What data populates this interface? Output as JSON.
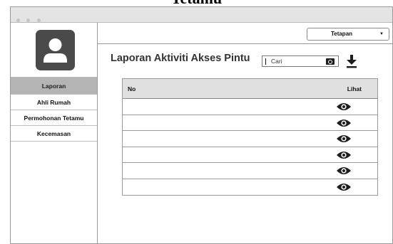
{
  "caption": "Tetamu",
  "window": {
    "dots": [
      "",
      "",
      ""
    ]
  },
  "sidebar": {
    "avatar_icon": "user-avatar-icon",
    "items": [
      {
        "label": "Laporan",
        "active": true
      },
      {
        "label": "Ahli Rumah",
        "active": false
      },
      {
        "label": "Permohonan Tetamu",
        "active": false
      },
      {
        "label": "Kecemasan",
        "active": false
      }
    ]
  },
  "header": {
    "dropdown_label": "Tetapan",
    "dropdown_icon": "caret-down-icon"
  },
  "main": {
    "title": "Laporan Aktiviti Akses Pintu",
    "search": {
      "placeholder": "Cari",
      "icon": "search-icon"
    },
    "download_icon": "download-icon",
    "table": {
      "columns": [
        "No",
        "Lihat"
      ],
      "rows": [
        {
          "no": "",
          "view_icon": "eye-icon"
        },
        {
          "no": "",
          "view_icon": "eye-icon"
        },
        {
          "no": "",
          "view_icon": "eye-icon"
        },
        {
          "no": "",
          "view_icon": "eye-icon"
        },
        {
          "no": "",
          "view_icon": "eye-icon"
        },
        {
          "no": "",
          "view_icon": "eye-icon"
        }
      ]
    }
  },
  "colors": {
    "active_nav": "#b4b4b4",
    "table_header": "#e0e0e0",
    "avatar_bg": "#4a4a4a",
    "icon": "#1e1e1e"
  }
}
